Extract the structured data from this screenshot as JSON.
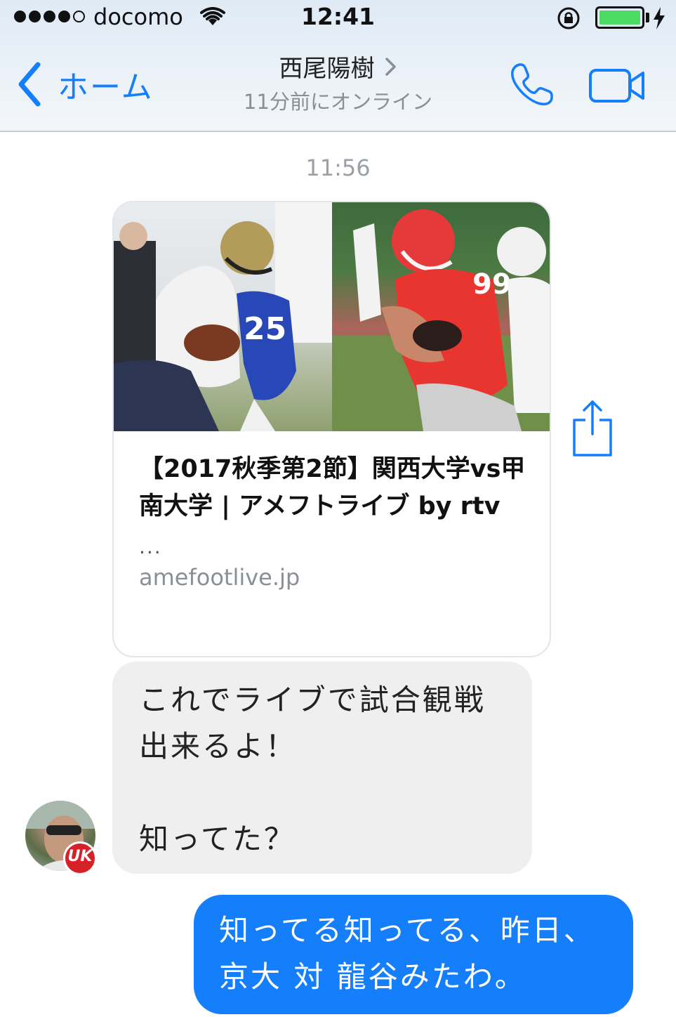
{
  "status_bar": {
    "carrier": "docomo",
    "time": "12:41",
    "battery_color": "#4cd964"
  },
  "header": {
    "back_label": "ホーム",
    "contact_name": "西尾陽樹",
    "contact_status": "11分前にオンライン",
    "icons": [
      "chevron-left-icon",
      "chevron-right-icon",
      "phone-icon",
      "video-camera-icon"
    ],
    "accent_color": "#147efb"
  },
  "chat": {
    "timestamp": "11:56",
    "link_card": {
      "title": "【2017秋季第2節】関西大学vs甲南大学 | アメフトライブ by rtv",
      "description": "...",
      "domain": "amefootlive.jp"
    },
    "incoming_message": "これでライブで試合観戦\n出来るよ！\n\n知ってた？",
    "outgoing_message": "知ってる知ってる、昨日、京大 対 龍谷みたわ。",
    "outgoing_color": "#147efb",
    "incoming_color": "#efefef"
  }
}
